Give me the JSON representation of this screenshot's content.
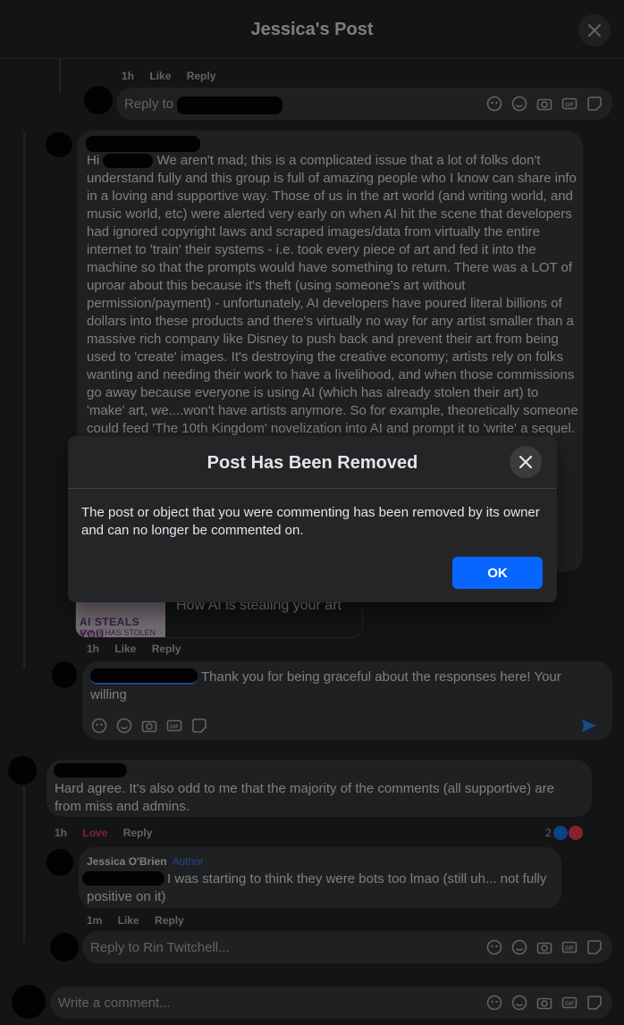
{
  "header": {
    "title": "Jessica's Post"
  },
  "actions": {
    "like": "Like",
    "reply": "Reply",
    "love": "Love"
  },
  "top_comment": {
    "time": "1h",
    "reply_placeholder": "Reply to"
  },
  "long_comment": {
    "greeting": "Hi",
    "text": "We aren't mad; this is a complicated issue that a lot of folks don't understand fully and this group is full of amazing people who I know can share info in a loving and supportive way. Those of us in the art world (and writing world, and music world, etc) were alerted very early on when AI hit the scene that developers had ignored copyright laws and scraped images/data from virtually the entire internet to 'train' their systems - i.e. took every piece of art and fed it into the machine so that the prompts would have something to return. There was a LOT of uproar about this because it's theft (using someone's art without permission/payment) - unfortunately, AI developers have poured literal billions of dollars into these products and there's virtually no way for any artist smaller than a massive rich company like Disney to push back and prevent their art from being used to 'create' images. It's destroying the creative economy; artists rely on folks wanting and needing their work to have a livelihood, and when those commissions go away because everyone is using AI (which has already stolen their art) to 'make' art, we....won't have artists anymore. So for example, theoretically someone could feed 'The 10th Kingdom' novelization into AI and prompt it to 'write' a sequel.",
    "link_title": "How AI is stealing your art",
    "link_thumb_line1": "AI STEALS YOU",
    "link_thumb_line2": "OW IT HAS STOLEN",
    "time": "1h"
  },
  "reply_draft": {
    "text": "Thank you for being graceful about the responses here! Your willing"
  },
  "rin_comment": {
    "text": "Hard agree. It's also odd to me that the majority of the comments (all supportive) are from miss and admins.",
    "time": "1h",
    "reaction_count": "2"
  },
  "jessica_reply": {
    "author": "Jessica O'Brien",
    "badge": "Author",
    "text": "I was starting to think they were bots too lmao (still uh... not fully positive on it)",
    "time": "1m"
  },
  "reply_rin": {
    "placeholder": "Reply to Rin Twitchell..."
  },
  "write_comment": {
    "placeholder": "Write a comment..."
  },
  "modal": {
    "title": "Post Has Been Removed",
    "body": "The post or object that you were commenting has been removed by its owner and can no longer be commented on.",
    "ok_label": "OK"
  },
  "icons": [
    "avatar-sticker-icon",
    "emoji-icon",
    "camera-icon",
    "gif-icon",
    "sticker-icon",
    "send-icon",
    "close-icon"
  ],
  "colors": {
    "accent": "#0866ff",
    "love": "#f33e58",
    "author": "#2d88ff",
    "background": "#242526"
  }
}
